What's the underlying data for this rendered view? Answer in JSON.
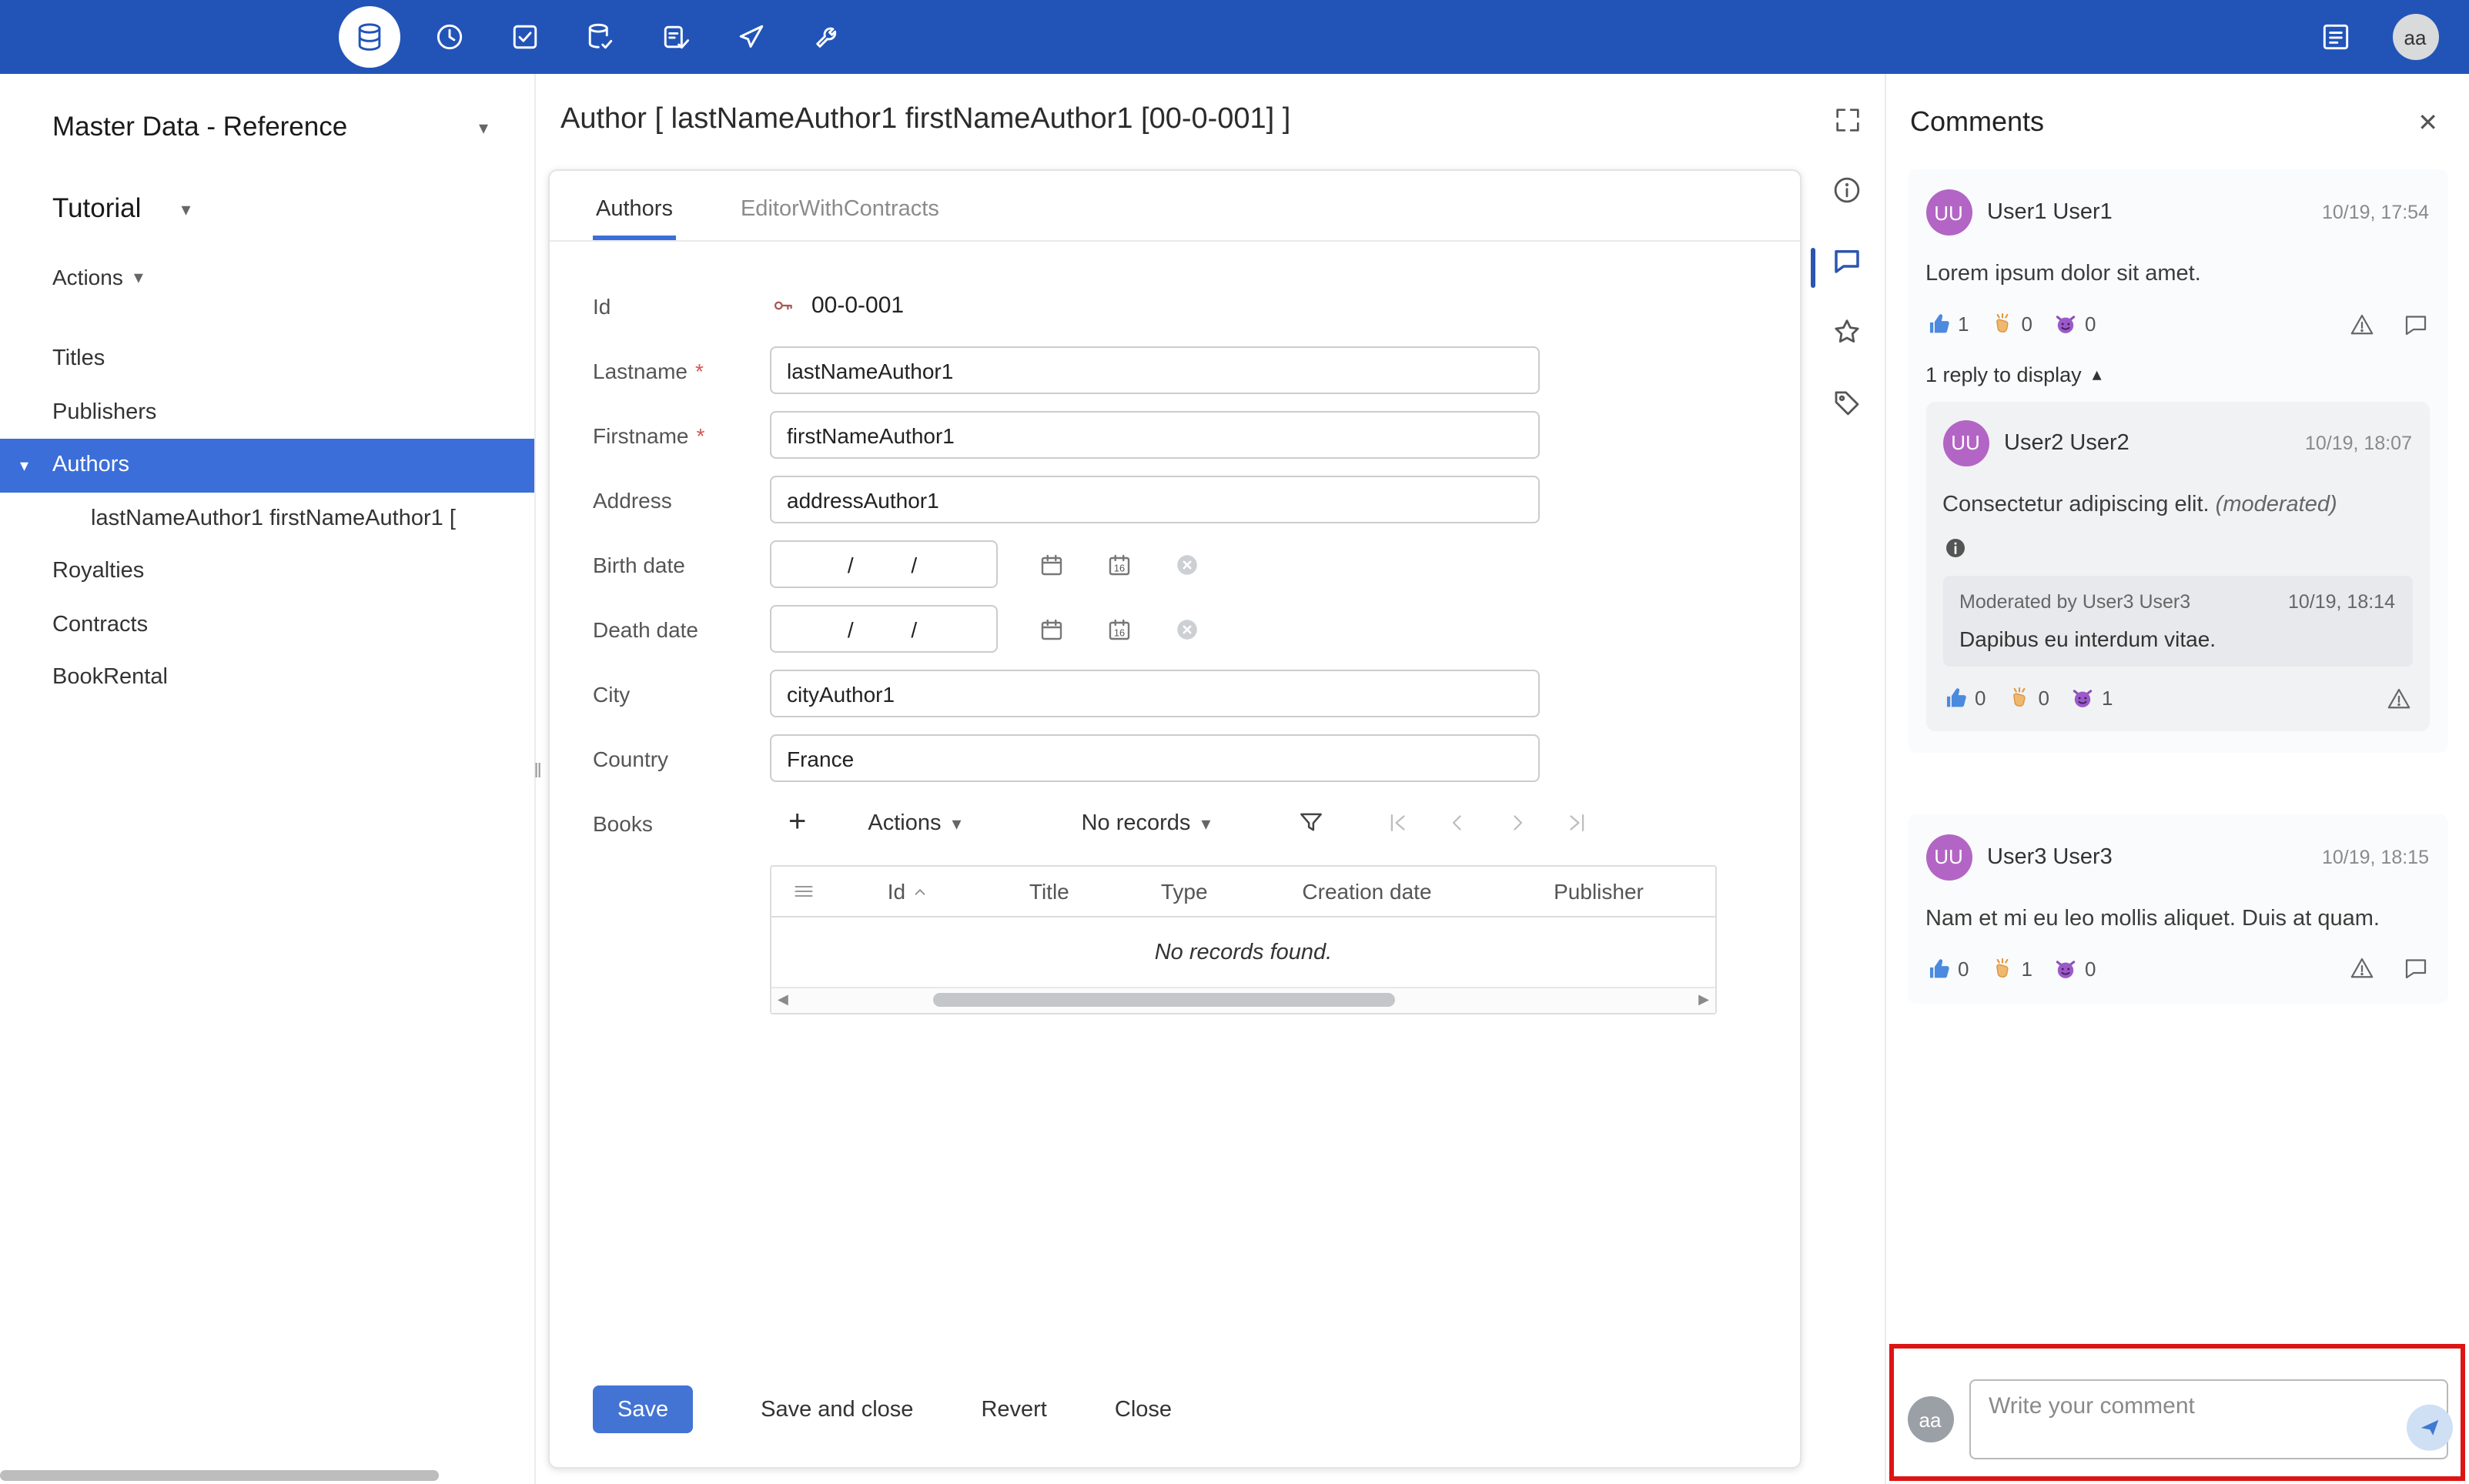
{
  "icons": {
    "chevron_down": "▾",
    "chevron_up": "▴",
    "tree_expanded": "▾",
    "close": "✕",
    "plus": "+",
    "resize": "‖",
    "required": "*",
    "arrow_left": "◀",
    "arrow_right": "▶"
  },
  "topbar": {
    "icon_names": [
      "database",
      "history",
      "checklist",
      "database-edit",
      "form-check",
      "dart",
      "wrench"
    ],
    "right_icon_name": "report-list",
    "avatar": "aa"
  },
  "sidebar": {
    "app_title": "Master Data - Reference",
    "section_label": "Tutorial",
    "actions_label": "Actions",
    "items": [
      {
        "label": "Titles"
      },
      {
        "label": "Publishers"
      },
      {
        "label": "Authors",
        "selected": true
      },
      {
        "label": "lastNameAuthor1 firstNameAuthor1 [",
        "child": true
      },
      {
        "label": "Royalties"
      },
      {
        "label": "Contracts"
      },
      {
        "label": "BookRental"
      }
    ]
  },
  "strip": {
    "icon_names": [
      "expand",
      "info",
      "comments",
      "star",
      "tag"
    ]
  },
  "main": {
    "title": "Author [ lastNameAuthor1 firstNameAuthor1 [00-0-001] ]",
    "tabs": [
      {
        "label": "Authors",
        "active": true
      },
      {
        "label": "EditorWithContracts",
        "active": false
      }
    ],
    "form": {
      "id": {
        "label": "Id",
        "value": "00-0-001"
      },
      "lastname": {
        "label": "Lastname",
        "value": "lastNameAuthor1"
      },
      "firstname": {
        "label": "Firstname",
        "value": "firstNameAuthor1"
      },
      "address": {
        "label": "Address",
        "value": "addressAuthor1"
      },
      "birth_date": {
        "label": "Birth date",
        "value": "/      /"
      },
      "death_date": {
        "label": "Death date",
        "value": "/      /"
      },
      "city": {
        "label": "City",
        "value": "cityAuthor1"
      },
      "country": {
        "label": "Country",
        "value": "France"
      },
      "books": {
        "label": "Books",
        "actions_label": "Actions",
        "records_label": "No records",
        "columns": [
          "Id",
          "Title",
          "Type",
          "Creation date",
          "Publisher"
        ],
        "empty_message": "No records found."
      }
    },
    "buttons": {
      "save": "Save",
      "save_close": "Save and close",
      "revert": "Revert",
      "close": "Close"
    }
  },
  "comments": {
    "title": "Comments",
    "items": [
      {
        "initials": "UU",
        "author": "User1 User1",
        "time": "10/19, 17:54",
        "text": "Lorem ipsum dolor sit amet.",
        "reactions": {
          "like": "1",
          "clap": "0",
          "devil": "0"
        },
        "replies_toggle": "1 reply to display",
        "reply": {
          "initials": "UU",
          "author": "User2 User2",
          "time": "10/19, 18:07",
          "text": "Consectetur adipiscing elit.",
          "moderated_tag": "(moderated)",
          "moderation": {
            "label": "Moderated by User3 User3",
            "time": "10/19, 18:14",
            "text": "Dapibus eu interdum vitae."
          },
          "reactions": {
            "like": "0",
            "clap": "0",
            "devil": "1"
          }
        }
      },
      {
        "initials": "UU",
        "author": "User3 User3",
        "time": "10/19, 18:15",
        "text": "Nam et mi eu leo mollis aliquet. Duis at quam.",
        "reactions": {
          "like": "0",
          "clap": "1",
          "devil": "0"
        }
      }
    ],
    "composer": {
      "avatar": "aa",
      "placeholder": "Write your comment"
    }
  }
}
